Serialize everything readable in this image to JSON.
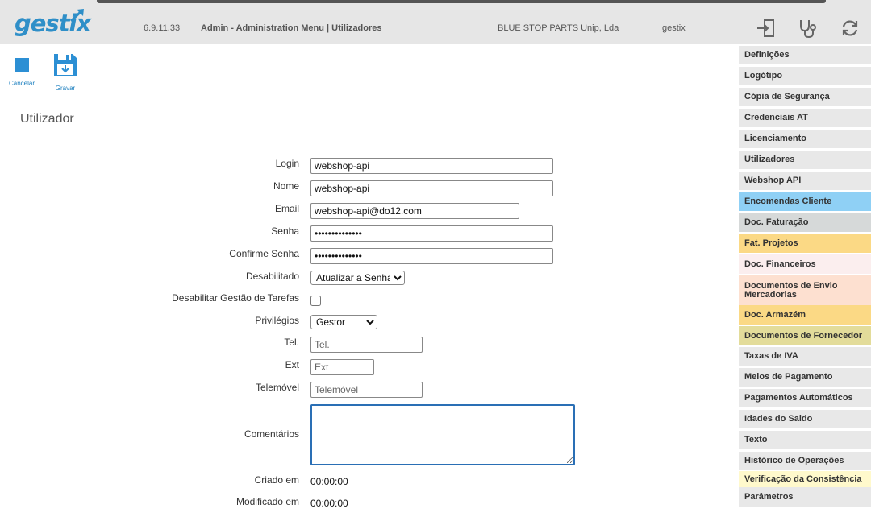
{
  "header": {
    "logo_text": "gestix",
    "version": "6.9.11.33",
    "title": "Admin - Administration Menu | Utilizadores",
    "company": "BLUE STOP PARTS Unip, Lda",
    "user": "gestix",
    "icons": [
      "logout-icon",
      "stethoscope-icon",
      "refresh-icon"
    ]
  },
  "toolbar": {
    "cancel_label": "Cancelar",
    "save_label": "Gravar"
  },
  "page_title": "Utilizador",
  "form": {
    "login_label": "Login",
    "login_value": "webshop-api",
    "name_label": "Nome",
    "name_value": "webshop-api",
    "email_label": "Email",
    "email_value": "webshop-api@do12.com",
    "password_label": "Senha",
    "password_value": "••••••••••••••",
    "confirm_label": "Confirme Senha",
    "confirm_value": "••••••••••••••",
    "disabled_label": "Desabilitado",
    "disabled_selected": "Atualizar a Senha",
    "tasks_label": "Desabilitar Gestão de Tarefas",
    "privileges_label": "Privilégios",
    "privileges_selected": "Gestor",
    "tel_label": "Tel.",
    "tel_placeholder": "Tel.",
    "ext_label": "Ext",
    "ext_placeholder": "Ext",
    "mobile_label": "Telemóvel",
    "mobile_placeholder": "Telemóvel",
    "comments_label": "Comentários",
    "created_label": "Criado em",
    "created_value": "00:00:00",
    "modified_label": "Modificado em",
    "modified_value": "00:00:00"
  },
  "sidebar": {
    "items": [
      {
        "label": "Definições",
        "color": "#e8e8e8"
      },
      {
        "label": "Logótipo",
        "color": "#e8e8e8"
      },
      {
        "label": "Cópia de Segurança",
        "color": "#e8e8e8"
      },
      {
        "label": "Credenciais AT",
        "color": "#e8e8e8"
      },
      {
        "label": "Licenciamento",
        "color": "#e8e8e8"
      },
      {
        "label": "Utilizadores",
        "color": "#e8e8e8"
      },
      {
        "label": "Webshop API",
        "color": "#e8e8e8"
      },
      {
        "label": "Encomendas Cliente",
        "color": "#8fd0f5"
      },
      {
        "label": "Doc. Faturação",
        "color": "#d6d9d9"
      },
      {
        "label": "Fat. Projetos",
        "color": "#fbd985"
      },
      {
        "label": "Doc. Financeiros",
        "color": "#fbeeee"
      },
      {
        "label": "Documentos de Envio Mercadorias",
        "color": "#fde0d0"
      },
      {
        "label": "Doc. Armazém",
        "color": "#fbd985"
      },
      {
        "label": "Documentos de Fornecedor",
        "color": "#e3dc9a"
      },
      {
        "label": "Taxas de IVA",
        "color": "#e8e8e8"
      },
      {
        "label": "Meios de Pagamento",
        "color": "#e8e8e8"
      },
      {
        "label": "Pagamentos Automáticos",
        "color": "#e8e8e8"
      },
      {
        "label": "Idades do Saldo",
        "color": "#e8e8e8"
      },
      {
        "label": "Texto",
        "color": "#e8e8e8"
      },
      {
        "label": "Histórico de Operações",
        "color": "#e8e8e8"
      },
      {
        "label": "Verificação da Consistência",
        "color": "#fff9cc"
      },
      {
        "label": "Parâmetros",
        "color": "#e8e8e8"
      }
    ]
  }
}
